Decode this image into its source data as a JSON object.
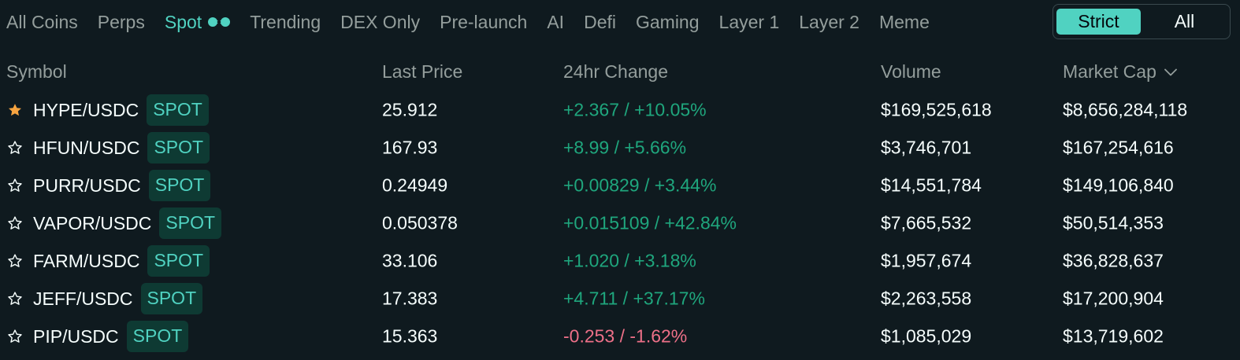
{
  "tabs": [
    {
      "label": "All Coins"
    },
    {
      "label": "Perps"
    },
    {
      "label": "Spot"
    },
    {
      "label": "Trending"
    },
    {
      "label": "DEX Only"
    },
    {
      "label": "Pre-launch"
    },
    {
      "label": "AI"
    },
    {
      "label": "Defi"
    },
    {
      "label": "Gaming"
    },
    {
      "label": "Layer 1"
    },
    {
      "label": "Layer 2"
    },
    {
      "label": "Meme"
    }
  ],
  "active_tab": "Spot",
  "mode_toggle": {
    "strict": "Strict",
    "all": "All",
    "selected": "Strict"
  },
  "columns": {
    "symbol": "Symbol",
    "last_price": "Last Price",
    "change": "24hr Change",
    "volume": "Volume",
    "market_cap": "Market Cap"
  },
  "sort": {
    "column": "Market Cap",
    "direction": "descending"
  },
  "rows": [
    {
      "symbol": "HYPE/USDC",
      "badge": "SPOT",
      "favorite": true,
      "price": "25.912",
      "change": "+2.367 / +10.05%",
      "direction": "up",
      "volume": "$169,525,618",
      "market_cap": "$8,656,284,118"
    },
    {
      "symbol": "HFUN/USDC",
      "badge": "SPOT",
      "favorite": false,
      "price": "167.93",
      "change": "+8.99 / +5.66%",
      "direction": "up",
      "volume": "$3,746,701",
      "market_cap": "$167,254,616"
    },
    {
      "symbol": "PURR/USDC",
      "badge": "SPOT",
      "favorite": false,
      "price": "0.24949",
      "change": "+0.00829 / +3.44%",
      "direction": "up",
      "volume": "$14,551,784",
      "market_cap": "$149,106,840"
    },
    {
      "symbol": "VAPOR/USDC",
      "badge": "SPOT",
      "favorite": false,
      "price": "0.050378",
      "change": "+0.015109 / +42.84%",
      "direction": "up",
      "volume": "$7,665,532",
      "market_cap": "$50,514,353"
    },
    {
      "symbol": "FARM/USDC",
      "badge": "SPOT",
      "favorite": false,
      "price": "33.106",
      "change": "+1.020 / +3.18%",
      "direction": "up",
      "volume": "$1,957,674",
      "market_cap": "$36,828,637"
    },
    {
      "symbol": "JEFF/USDC",
      "badge": "SPOT",
      "favorite": false,
      "price": "17.383",
      "change": "+4.711 / +37.17%",
      "direction": "up",
      "volume": "$2,263,558",
      "market_cap": "$17,200,904"
    },
    {
      "symbol": "PIP/USDC",
      "badge": "SPOT",
      "favorite": false,
      "price": "15.363",
      "change": "-0.253 / -1.62%",
      "direction": "down",
      "volume": "$1,085,029",
      "market_cap": "$13,719,602"
    }
  ],
  "colors": {
    "accent": "#50d2c1",
    "positive": "#1fa67d",
    "negative": "#ed7088",
    "favorite_star": "#f7a440",
    "background": "#0f1a1f"
  },
  "icons": {
    "favorite": "star-filled-icon",
    "not_favorite": "star-outline-icon",
    "spot_toggle": "toggle-icon",
    "sort": "chevron-down-icon"
  }
}
